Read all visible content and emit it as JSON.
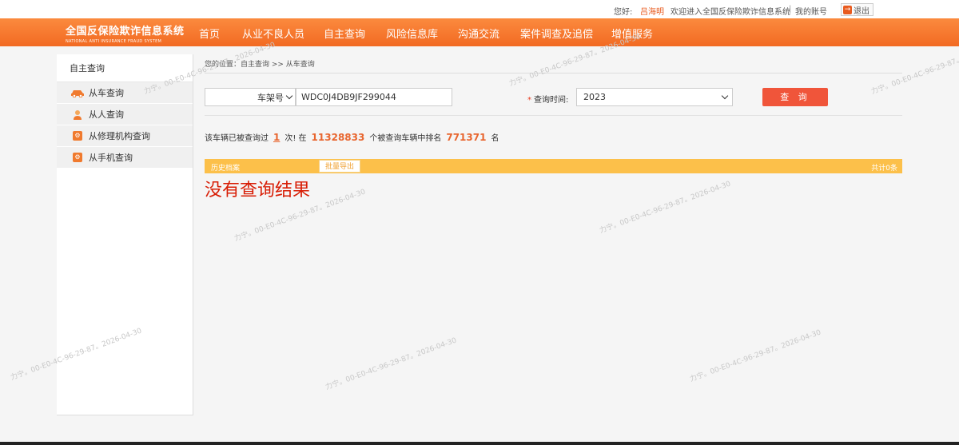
{
  "topbar": {
    "hello": "您好:",
    "username": "吕海明",
    "welcome": "欢迎进入全国反保险欺诈信息系统",
    "separator": "|",
    "my_account": "我的账号",
    "logout": "退出"
  },
  "logo": {
    "cn": "全国反保险欺诈信息系统",
    "en": "NATIONAL ANTI INSURANCE FRAUD SYSTEM"
  },
  "nav": {
    "items": [
      "首页",
      "从业不良人员",
      "自主查询",
      "风险信息库",
      "沟通交流",
      "案件调查及追偿",
      "增值服务"
    ]
  },
  "sidebar": {
    "title": "自主查询",
    "items": [
      {
        "label": "从车查询",
        "icon": "car-icon"
      },
      {
        "label": "从人查询",
        "icon": "person-icon"
      },
      {
        "label": "从修理机构查询",
        "icon": "repair-shop-icon"
      },
      {
        "label": "从手机查询",
        "icon": "phone-icon"
      }
    ]
  },
  "breadcrumb": "您的位置：自主查询 >> 从车查询",
  "search": {
    "type_value": "车架号",
    "vin_value": "WDC0J4DB9JF299044",
    "time_label": "查询时间:",
    "required_mark": "*",
    "year_value": "2023",
    "query_button": "查 询"
  },
  "stats": {
    "prefix": "该车辆已被查询过",
    "count": "1",
    "middle": "次! 在",
    "total": "11328833",
    "rank_text": "个被查询车辆中排名",
    "rank": "771371",
    "suffix": "名"
  },
  "history": {
    "title": "历史档案",
    "export_button": "批量导出",
    "total": "共计0条"
  },
  "no_result": "没有查询结果",
  "watermark_text": "力宁。00-E0-4C-96-29-87。2026-04-30",
  "colors": {
    "nav_orange": "#f26a22",
    "accent_red": "#d81e06",
    "history_bar": "#fcc04a",
    "query_button": "#f0553a"
  }
}
